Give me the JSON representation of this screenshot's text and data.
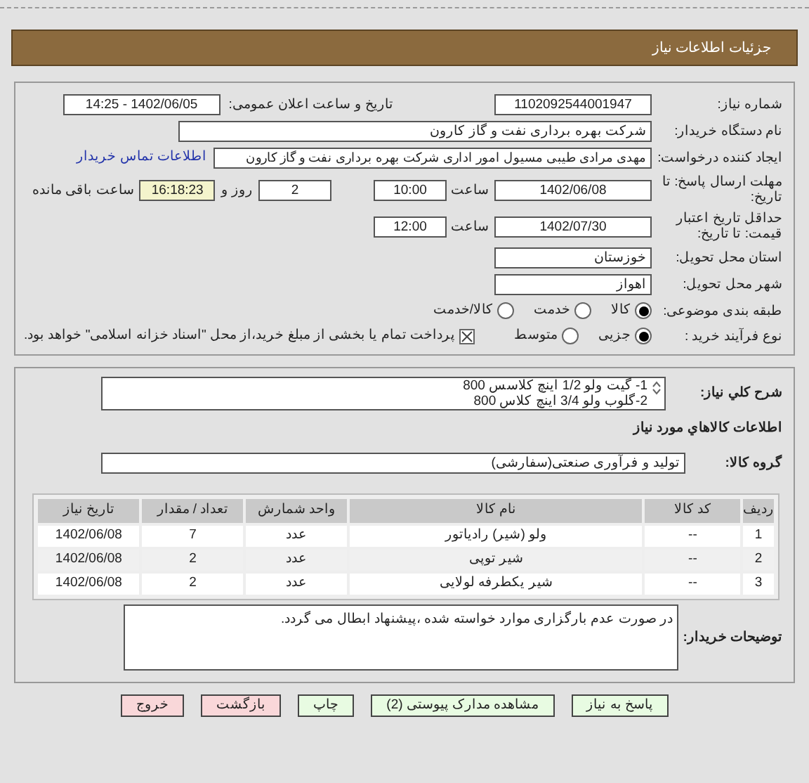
{
  "header": {
    "title": "جزئیات اطلاعات نیاز"
  },
  "details": {
    "need_number": {
      "label": "شماره نیاز:",
      "value": "1102092544001947"
    },
    "announce": {
      "label": "تاریخ و ساعت اعلان عمومی:",
      "value": "1402/06/05 - 14:25"
    },
    "buyer": {
      "label": "نام دستگاه خریدار:",
      "value": "شرکت بهره برداری نفت و گاز کارون"
    },
    "creator": {
      "label": "ایجاد کننده درخواست:",
      "value": "مهدی مرادی طیبی مسیول امور اداری شرکت بهره برداری نفت و گاز کارون",
      "link": "اطلاعات تماس خریدار"
    },
    "deadline": {
      "label": "مهلت ارسال پاسخ: تا تاریخ:",
      "date": "1402/06/08",
      "time_label": "ساعت",
      "time": "10:00",
      "days": "2",
      "days_label": "روز و",
      "remaining": "16:18:23",
      "remaining_label": "ساعت باقی مانده"
    },
    "validity": {
      "label": "حداقل تاریخ اعتبار قیمت: تا تاریخ:",
      "date": "1402/07/30",
      "time_label": "ساعت",
      "time": "12:00"
    },
    "province": {
      "label": "استان محل تحویل:",
      "value": "خوزستان"
    },
    "city": {
      "label": "شهر محل تحویل:",
      "value": "اهواز"
    },
    "category": {
      "label": "طبقه بندی موضوعی:",
      "options": [
        {
          "label": "کالا",
          "selected": true
        },
        {
          "label": "خدمت",
          "selected": false
        },
        {
          "label": "کالا/خدمت",
          "selected": false
        }
      ]
    },
    "process": {
      "label": "نوع فرآیند خرید :",
      "options": [
        {
          "label": "جزیی",
          "selected": true
        },
        {
          "label": "متوسط",
          "selected": false
        }
      ],
      "treasury": {
        "checked": true,
        "label": "پرداخت تمام یا بخشی از مبلغ خرید،از محل \"اسناد خزانه اسلامی\" خواهد بود."
      }
    }
  },
  "needs": {
    "description_label": "شرح کلي نياز:",
    "description": [
      "1- گیت ولو 1/2 اینچ کلاسس 800",
      "2-گلوب ولو 3/4 اینچ کلاس 800"
    ],
    "goods_title": "اطلاعات کالاهاي مورد نياز",
    "group_label": "گروه کالا:",
    "group": "تولید و فرآوری صنعتی(سفارشی)",
    "table": {
      "columns": [
        "ردیف",
        "کد کالا",
        "نام کالا",
        "واحد شمارش",
        "تعداد / مقدار",
        "تاریخ نیاز"
      ],
      "rows": [
        [
          "1",
          "--",
          "ولو (شیر) رادیاتور",
          "عدد",
          "7",
          "1402/06/08"
        ],
        [
          "2",
          "--",
          "شیر توپی",
          "عدد",
          "2",
          "1402/06/08"
        ],
        [
          "3",
          "--",
          "شیر یکطرفه لولایی",
          "عدد",
          "2",
          "1402/06/08"
        ]
      ]
    },
    "notes_label": "توضیحات خریدار:",
    "notes": "در صورت عدم بارگزاری موارد خواسته شده ،پیشنهاد ابطال می گردد."
  },
  "buttons": [
    {
      "label": "پاسخ به نیاز",
      "kind": "ok"
    },
    {
      "label": "مشاهده مدارک پیوستی (2)",
      "kind": "ok"
    },
    {
      "label": "چاپ",
      "kind": "ok"
    },
    {
      "label": "بازگشت",
      "kind": "back"
    },
    {
      "label": "خروج",
      "kind": "back"
    }
  ]
}
